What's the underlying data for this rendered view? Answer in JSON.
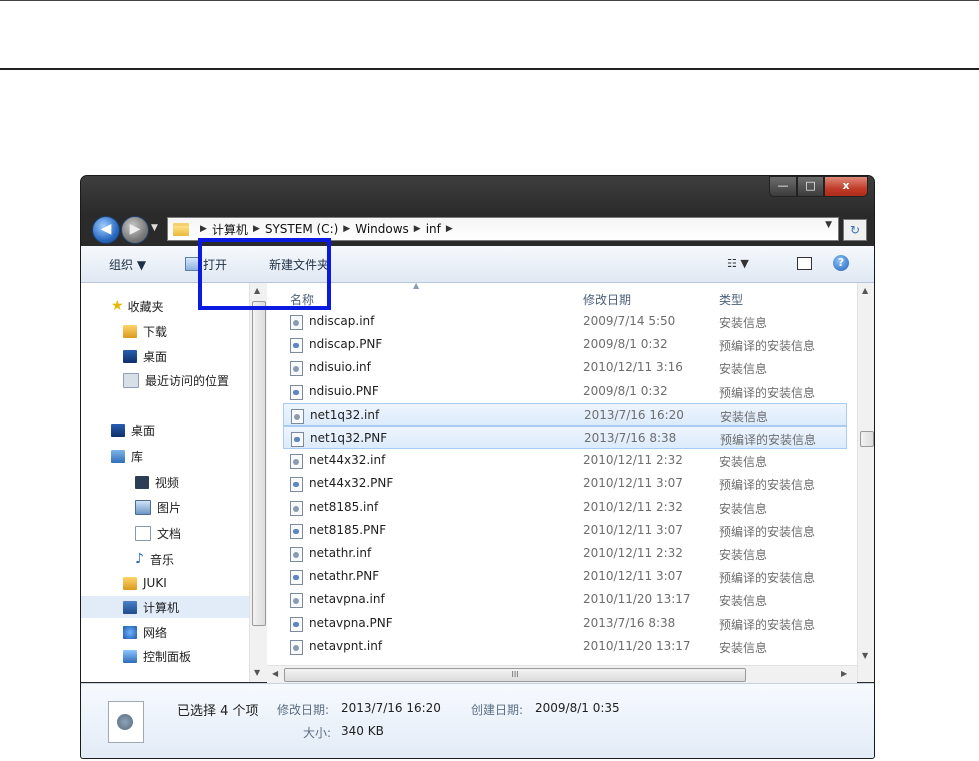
{
  "window": {
    "controls": {
      "minimize": "—",
      "maximize": "□",
      "close": "x"
    }
  },
  "address": {
    "breadcrumbs": [
      "计算机",
      "SYSTEM (C:)",
      "Windows",
      "inf"
    ]
  },
  "toolbar": {
    "organize": "组织 ▼",
    "open": "打开",
    "new_folder": "新建文件夹",
    "view": "☷ ▼",
    "help": "?"
  },
  "nav": {
    "favorites": "收藏夹",
    "downloads": "下载",
    "desktop_fav": "桌面",
    "recent": "最近访问的位置",
    "desktop": "桌面",
    "libraries": "库",
    "videos": "视频",
    "pictures": "图片",
    "documents": "文档",
    "music": "音乐",
    "juki": "JUKI",
    "computer": "计算机",
    "network": "网络",
    "control_panel": "控制面板"
  },
  "columns": {
    "name": "名称",
    "date": "修改日期",
    "type": "类型"
  },
  "files": [
    {
      "name": "ndiscap.inf",
      "date": "2009/7/14 5:50",
      "type": "安装信息",
      "kind": "inf",
      "selected": false
    },
    {
      "name": "ndiscap.PNF",
      "date": "2009/8/1 0:32",
      "type": "预编译的安装信息",
      "kind": "pnf",
      "selected": false
    },
    {
      "name": "ndisuio.inf",
      "date": "2010/12/11 3:16",
      "type": "安装信息",
      "kind": "inf",
      "selected": false
    },
    {
      "name": "ndisuio.PNF",
      "date": "2009/8/1 0:32",
      "type": "预编译的安装信息",
      "kind": "pnf",
      "selected": false
    },
    {
      "name": "net1q32.inf",
      "date": "2013/7/16 16:20",
      "type": "安装信息",
      "kind": "inf",
      "selected": true
    },
    {
      "name": "net1q32.PNF",
      "date": "2013/7/16 8:38",
      "type": "预编译的安装信息",
      "kind": "pnf",
      "selected": true
    },
    {
      "name": "net44x32.inf",
      "date": "2010/12/11 2:32",
      "type": "安装信息",
      "kind": "inf",
      "selected": false
    },
    {
      "name": "net44x32.PNF",
      "date": "2010/12/11 3:07",
      "type": "预编译的安装信息",
      "kind": "pnf",
      "selected": false
    },
    {
      "name": "net8185.inf",
      "date": "2010/12/11 2:32",
      "type": "安装信息",
      "kind": "inf",
      "selected": false
    },
    {
      "name": "net8185.PNF",
      "date": "2010/12/11 3:07",
      "type": "预编译的安装信息",
      "kind": "pnf",
      "selected": false
    },
    {
      "name": "netathr.inf",
      "date": "2010/12/11 2:32",
      "type": "安装信息",
      "kind": "inf",
      "selected": false
    },
    {
      "name": "netathr.PNF",
      "date": "2010/12/11 3:07",
      "type": "预编译的安装信息",
      "kind": "pnf",
      "selected": false
    },
    {
      "name": "netavpna.inf",
      "date": "2010/11/20 13:17",
      "type": "安装信息",
      "kind": "inf",
      "selected": false
    },
    {
      "name": "netavpna.PNF",
      "date": "2013/7/16 8:38",
      "type": "预编译的安装信息",
      "kind": "pnf",
      "selected": false
    },
    {
      "name": "netavpnt.inf",
      "date": "2010/11/20 13:17",
      "type": "安装信息",
      "kind": "inf",
      "selected": false
    }
  ],
  "status": {
    "selected_count": "已选择 4 个项",
    "modified_label": "修改日期:",
    "modified_value": "2013/7/16 16:20",
    "created_label": "创建日期:",
    "created_value": "2009/8/1 0:35",
    "size_label": "大小:",
    "size_value": "340 KB"
  },
  "colors": {
    "highlight_box": "#0a1ae0",
    "selection": "#dcebfc"
  }
}
